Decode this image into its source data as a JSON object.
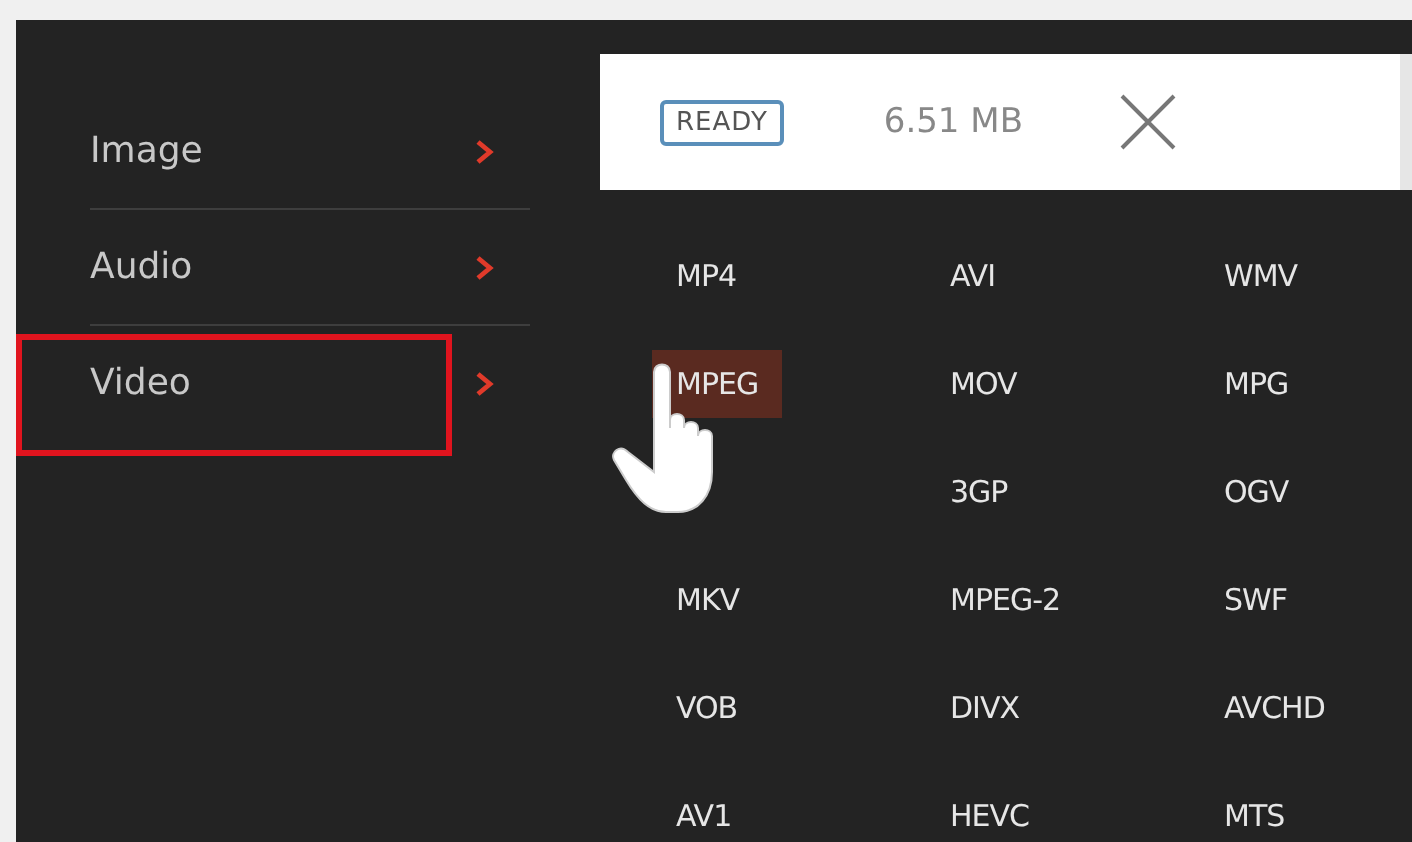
{
  "menu": [
    {
      "label": "Image",
      "highlighted": false
    },
    {
      "label": "Audio",
      "highlighted": false
    },
    {
      "label": "Video",
      "highlighted": true
    }
  ],
  "panel": {
    "status": "READY",
    "size": "6.51 MB"
  },
  "formats": [
    {
      "label": "MP4",
      "selected": false
    },
    {
      "label": "AVI",
      "selected": false
    },
    {
      "label": "WMV",
      "selected": false
    },
    {
      "label": "MPEG",
      "selected": true
    },
    {
      "label": "MOV",
      "selected": false
    },
    {
      "label": "MPG",
      "selected": false
    },
    {
      "label": "3GP",
      "selected": false
    },
    {
      "label": "OGV",
      "selected": false
    },
    {
      "label": "MKV",
      "selected": false
    },
    {
      "label": "MPEG-2",
      "selected": false
    },
    {
      "label": "SWF",
      "selected": false
    },
    {
      "label": "VOB",
      "selected": false
    },
    {
      "label": "DIVX",
      "selected": false
    },
    {
      "label": "AVCHD",
      "selected": false
    },
    {
      "label": "AV1",
      "selected": false
    },
    {
      "label": "HEVC",
      "selected": false
    },
    {
      "label": "MTS",
      "selected": false
    }
  ]
}
